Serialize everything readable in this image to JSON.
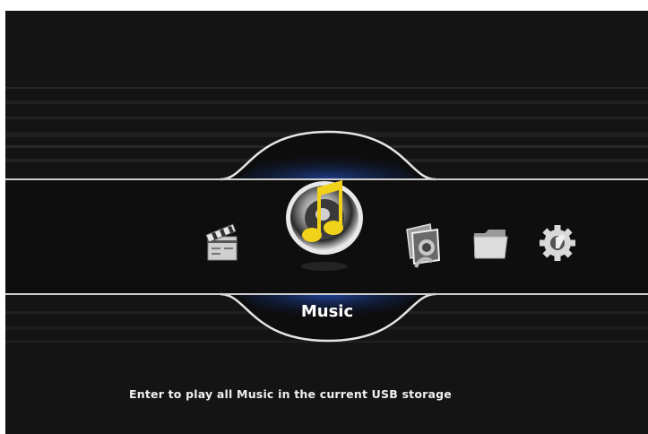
{
  "menu": {
    "items": [
      {
        "id": "movie",
        "icon": "clapperboard-icon",
        "label": "Movie",
        "selected": false
      },
      {
        "id": "music",
        "icon": "music-note-icon",
        "label": "Music",
        "selected": true
      },
      {
        "id": "photo",
        "icon": "photo-icon",
        "label": "Photo",
        "selected": false
      },
      {
        "id": "file",
        "icon": "folder-icon",
        "label": "File",
        "selected": false
      },
      {
        "id": "setup",
        "icon": "gear-icon",
        "label": "Setup",
        "selected": false
      }
    ],
    "selected_label": "Music"
  },
  "status": {
    "hint": "Enter to play all Music in the current USB storage"
  },
  "colors": {
    "background": "#141414",
    "rail": "#cfcfcf",
    "glow": "#2a5cd6",
    "text": "#ffffff",
    "note": "#f0d21a"
  }
}
